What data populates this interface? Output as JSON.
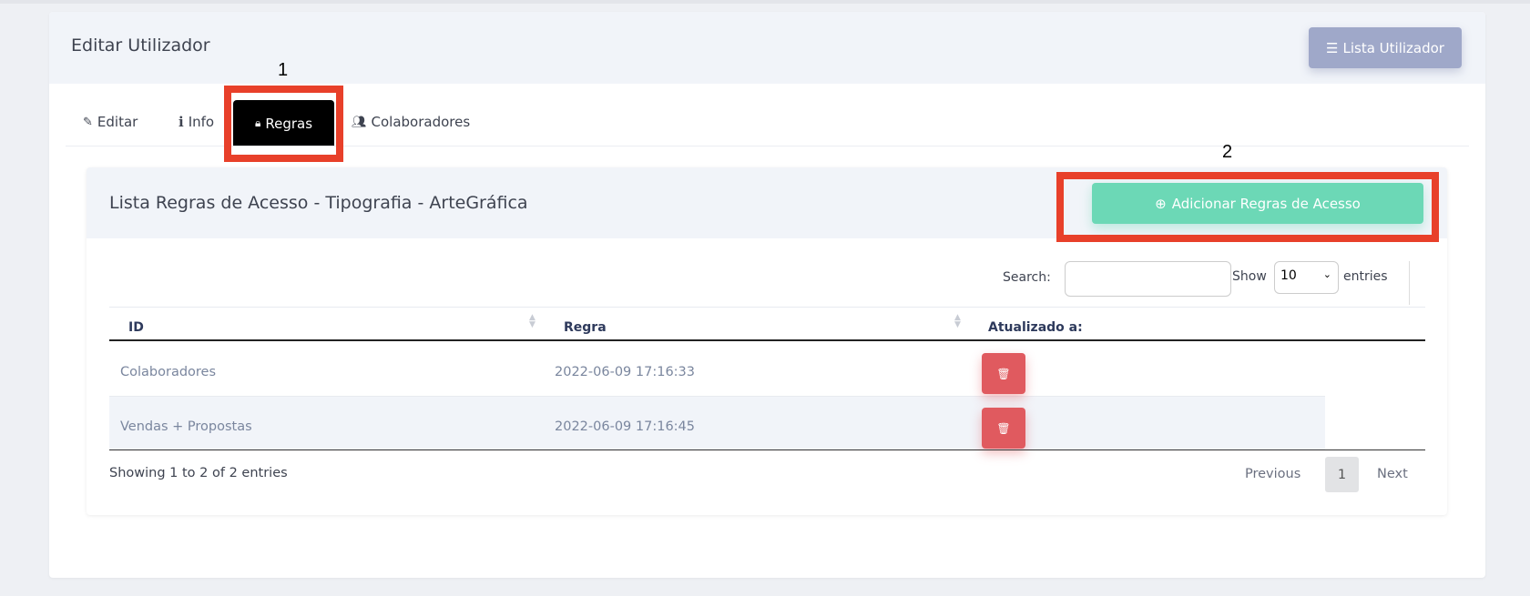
{
  "page": {
    "title": "Editar Utilizador",
    "list_button": "Lista Utilizador",
    "list_icon": "list-icon"
  },
  "tabs": [
    {
      "label": "Editar",
      "icon": "edit-icon"
    },
    {
      "label": "Info",
      "icon": "info-icon"
    },
    {
      "label": "Regras",
      "icon": "lock-icon",
      "active": true
    },
    {
      "label": "Colaboradores",
      "icon": "users-icon"
    }
  ],
  "annotations": [
    "1",
    "2"
  ],
  "panel": {
    "title": "Lista Regras de Acesso - Tipografia - ArteGráfica",
    "add_button": "Adicionar Regras de Acesso",
    "search_label": "Search:",
    "search_value": "",
    "show_label": "Show",
    "entries_value": "10",
    "entries_label": "entries",
    "columns": [
      "ID",
      "Regra",
      "Atualizado a:"
    ],
    "rows": [
      {
        "id": "Colaboradores",
        "regra": "2022-06-09 17:16:33"
      },
      {
        "id": "Vendas + Propostas",
        "regra": "2022-06-09 17:16:45"
      }
    ],
    "info": "Showing 1 to 2 of 2 entries",
    "pagination": {
      "previous": "Previous",
      "current": "1",
      "next": "Next"
    }
  },
  "colors": {
    "accent_add": "#6cd8b6",
    "list_button": "#9fa8c9",
    "delete": "#e05a5f",
    "active_tab": "#000000",
    "annotation_box": "#e8402a"
  }
}
